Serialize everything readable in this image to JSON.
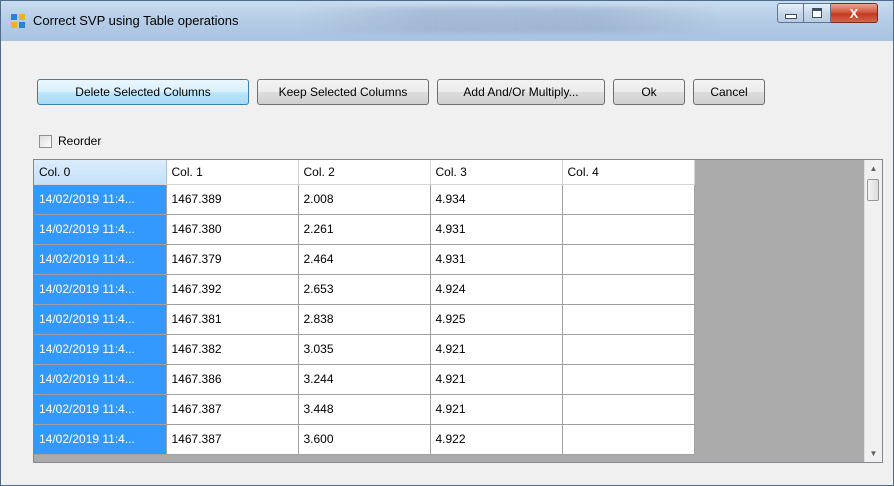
{
  "window": {
    "title": "Correct SVP using Table operations",
    "close_glyph": "X"
  },
  "toolbar": {
    "delete_label": "Delete Selected Columns",
    "keep_label": "Keep Selected Columns",
    "add_multiply_label": "Add And/Or Multiply...",
    "ok_label": "Ok",
    "cancel_label": "Cancel"
  },
  "reorder": {
    "label": "Reorder",
    "checked": false
  },
  "grid": {
    "columns": [
      "Col. 0",
      "Col. 1",
      "Col. 2",
      "Col. 3",
      "Col. 4"
    ],
    "selected_column": 0,
    "rows": [
      [
        "14/02/2019 11:4...",
        "1467.389",
        "2.008",
        "4.934",
        ""
      ],
      [
        "14/02/2019 11:4...",
        "1467.380",
        "2.261",
        "4.931",
        ""
      ],
      [
        "14/02/2019 11:4...",
        "1467.379",
        "2.464",
        "4.931",
        ""
      ],
      [
        "14/02/2019 11:4...",
        "1467.392",
        "2.653",
        "4.924",
        ""
      ],
      [
        "14/02/2019 11:4...",
        "1467.381",
        "2.838",
        "4.925",
        ""
      ],
      [
        "14/02/2019 11:4...",
        "1467.382",
        "3.035",
        "4.921",
        ""
      ],
      [
        "14/02/2019 11:4...",
        "1467.386",
        "3.244",
        "4.921",
        ""
      ],
      [
        "14/02/2019 11:4...",
        "1467.387",
        "3.448",
        "4.921",
        ""
      ],
      [
        "14/02/2019 11:4...",
        "1467.387",
        "3.600",
        "4.922",
        ""
      ]
    ]
  },
  "colors": {
    "selection": "#3399ff",
    "grid_background": "#ababab",
    "focused_button_border": "#3c7fb1"
  },
  "icons": {
    "app": "window-form-icon",
    "scroll_up": "arrow-up-icon",
    "scroll_down": "arrow-down-icon"
  }
}
